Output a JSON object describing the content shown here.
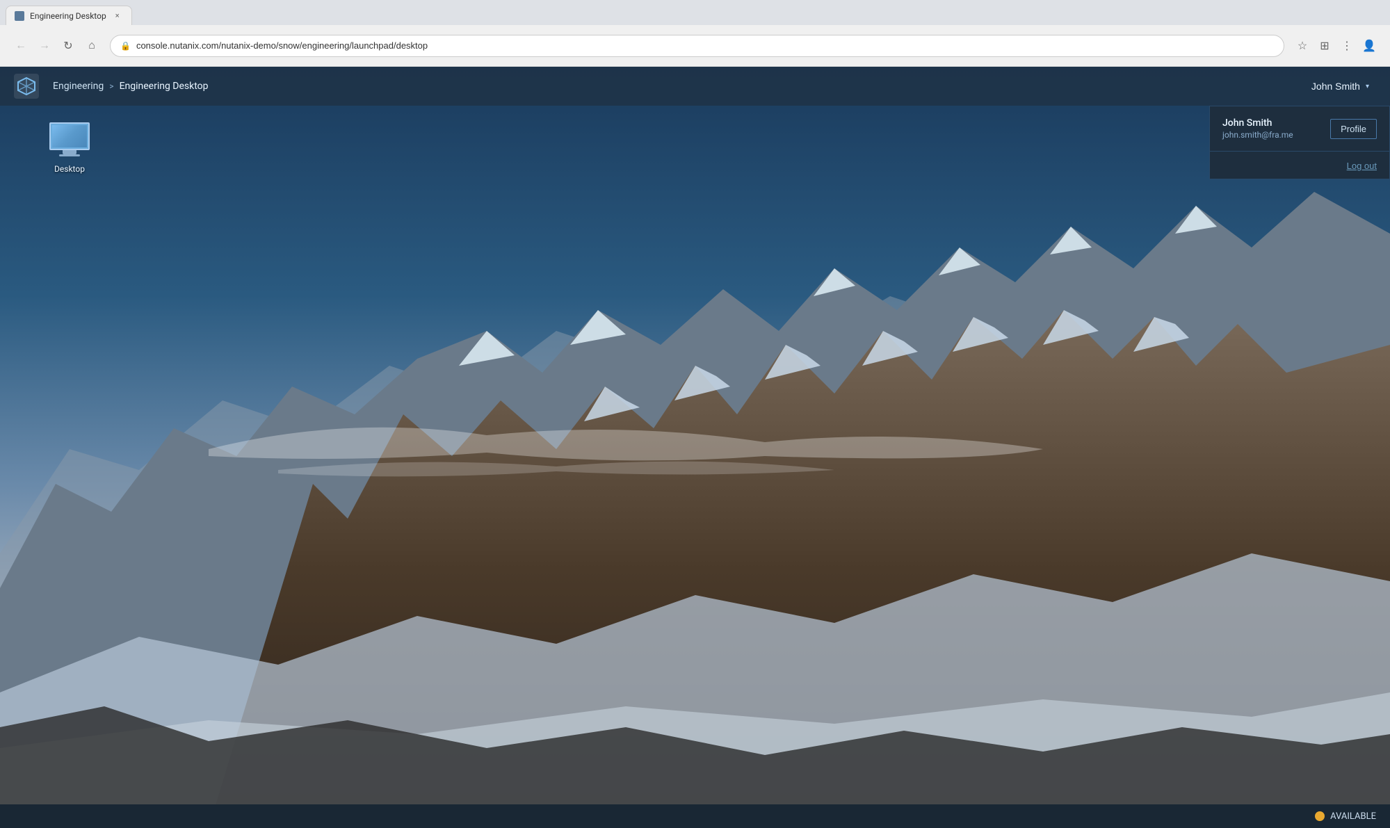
{
  "browser": {
    "url": "console.nutanix.com/nutanix-demo/snow/engineering/launchpad/desktop",
    "tab_title": "Engineering Desktop"
  },
  "header": {
    "breadcrumb_root": "Engineering",
    "breadcrumb_separator": ">",
    "breadcrumb_current": "Engineering Desktop",
    "user_name": "John Smith",
    "chevron": "▾"
  },
  "dropdown": {
    "user_name": "John Smith",
    "user_email": "john.smith@fra.me",
    "profile_button": "Profile",
    "logout_link": "Log out"
  },
  "desktop_icon": {
    "label": "Desktop"
  },
  "status_bar": {
    "available_label": "AVAILABLE"
  }
}
